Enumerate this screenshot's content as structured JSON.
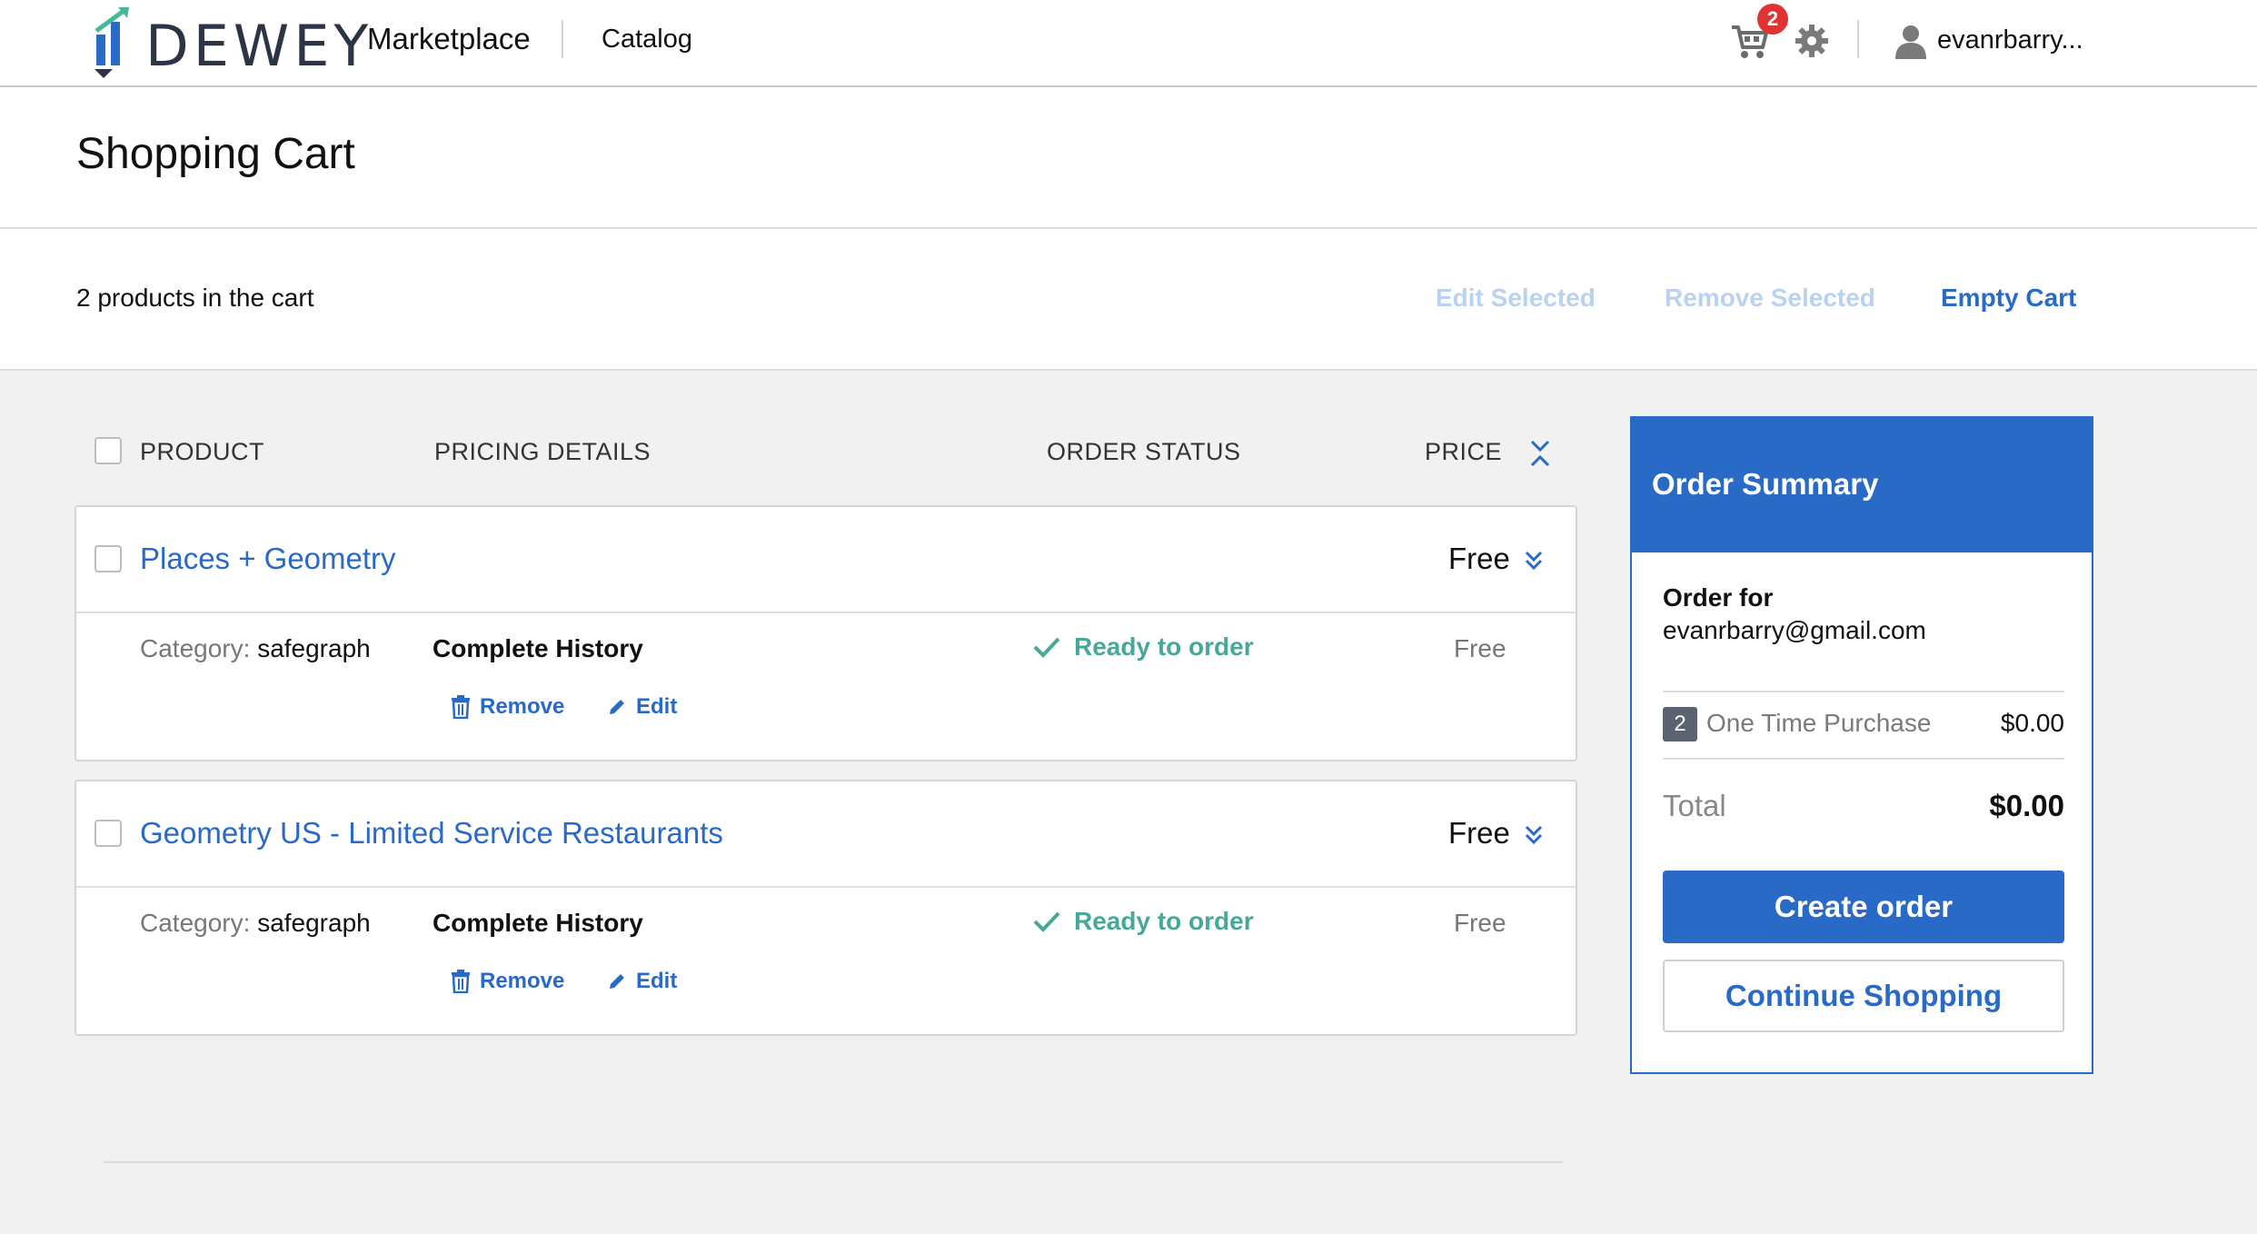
{
  "nav": {
    "logo_text": "DEWEY",
    "marketplace": "Marketplace",
    "catalog": "Catalog",
    "cart_count": "2",
    "user_name": "evanrbarry..."
  },
  "page": {
    "title": "Shopping Cart",
    "cart_summary": "2 products in the cart"
  },
  "toolbar": {
    "edit_selected": "Edit Selected",
    "remove_selected": "Remove Selected",
    "empty_cart": "Empty Cart"
  },
  "table": {
    "headers": {
      "product": "PRODUCT",
      "pricing": "PRICING DETAILS",
      "status": "ORDER STATUS",
      "price": "PRICE"
    }
  },
  "items": [
    {
      "title": "Places + Geometry",
      "price": "Free",
      "category_label": "Category:",
      "category_value": "safegraph",
      "plan": "Complete History",
      "remove": "Remove",
      "edit": "Edit",
      "status": "Ready to order",
      "row_price": "Free"
    },
    {
      "title": "Geometry US - Limited Service Restaurants",
      "price": "Free",
      "category_label": "Category:",
      "category_value": "safegraph",
      "plan": "Complete History",
      "remove": "Remove",
      "edit": "Edit",
      "status": "Ready to order",
      "row_price": "Free"
    }
  ],
  "summary": {
    "title": "Order Summary",
    "order_for_label": "Order for",
    "email": "evanrbarry@gmail.com",
    "qty": "2",
    "item_label": "One Time Purchase",
    "item_price": "$0.00",
    "total_label": "Total",
    "total": "$0.00",
    "create_order": "Create order",
    "continue_shopping": "Continue Shopping"
  },
  "colors": {
    "accent": "#2a6ac7",
    "disabled": "#b9d2ef",
    "success": "#46a897",
    "badge": "#e03434"
  },
  "icons": [
    "dewey-logo-icon",
    "cart-icon",
    "gear-icon",
    "user-icon",
    "collapse-all-icon",
    "chevron-double-down-icon",
    "trash-icon",
    "pencil-icon",
    "check-icon"
  ]
}
